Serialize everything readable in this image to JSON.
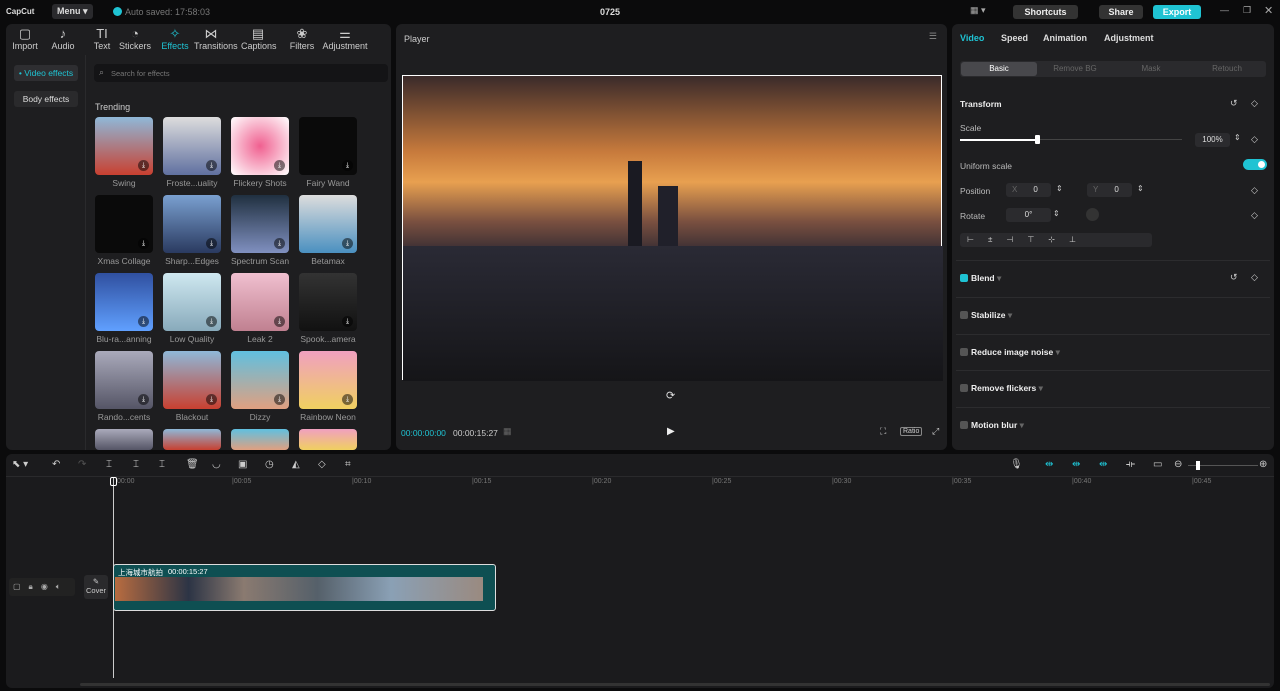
{
  "app": {
    "logo": "CapCut",
    "menu": "Menu",
    "autosave": "Auto saved: 17:58:03",
    "project": "0725",
    "shortcuts": "Shortcuts",
    "share": "Share",
    "export": "Export",
    "accent": "#1fc3d3"
  },
  "toolbar": [
    {
      "label": "Import",
      "icon": "▢"
    },
    {
      "label": "Audio",
      "icon": "♪"
    },
    {
      "label": "Text",
      "icon": "TI"
    },
    {
      "label": "Stickers",
      "icon": "◔"
    },
    {
      "label": "Effects",
      "icon": "✧"
    },
    {
      "label": "Transitions",
      "icon": "⋈"
    },
    {
      "label": "Captions",
      "icon": "▤"
    },
    {
      "label": "Filters",
      "icon": "❀"
    },
    {
      "label": "Adjustment",
      "icon": "⚌"
    }
  ],
  "effects": {
    "side": [
      "• Video effects",
      "Body effects"
    ],
    "search_placeholder": "Search for effects",
    "section": "Trending",
    "items": [
      "Swing",
      "Froste...uality",
      "Flickery Shots",
      "Fairy Wand",
      "Xmas Collage",
      "Sharp...Edges",
      "Spectrum Scan",
      "Betamax",
      "Blu-ra...anning",
      "Low Quality",
      "Leak 2",
      "Spook...amera",
      "Rando...cents",
      "Blackout",
      "Dizzy",
      "Rainbow Neon"
    ]
  },
  "player": {
    "title": "Player",
    "time_current": "00:00:00:00",
    "time_total": "00:00:15:27",
    "ratio": "Ratio"
  },
  "inspector": {
    "tabs": [
      "Video",
      "Speed",
      "Animation",
      "Adjustment"
    ],
    "subtabs": [
      "Basic",
      "Remove BG",
      "Mask",
      "Retouch"
    ],
    "transform": "Transform",
    "scale_label": "Scale",
    "scale_value": "100%",
    "scale_fraction": 0.28,
    "uniform": "Uniform scale",
    "uniform_on": true,
    "position": "Position",
    "x_label": "X",
    "x": "0",
    "y_label": "Y",
    "y": "0",
    "rotate": "Rotate",
    "rotate_value": "0°",
    "sections": [
      "Blend",
      "Stabilize",
      "Reduce image noise",
      "Remove flickers",
      "Motion blur"
    ]
  },
  "timeline": {
    "ticks": [
      "00:00",
      "|00:05",
      "|00:10",
      "|00:15",
      "|00:20",
      "|00:25",
      "|00:30",
      "|00:35",
      "|00:40",
      "|00:45"
    ],
    "cover": "Cover",
    "clip_name": "上海城市航拍",
    "clip_duration": "00:00:15:27"
  }
}
